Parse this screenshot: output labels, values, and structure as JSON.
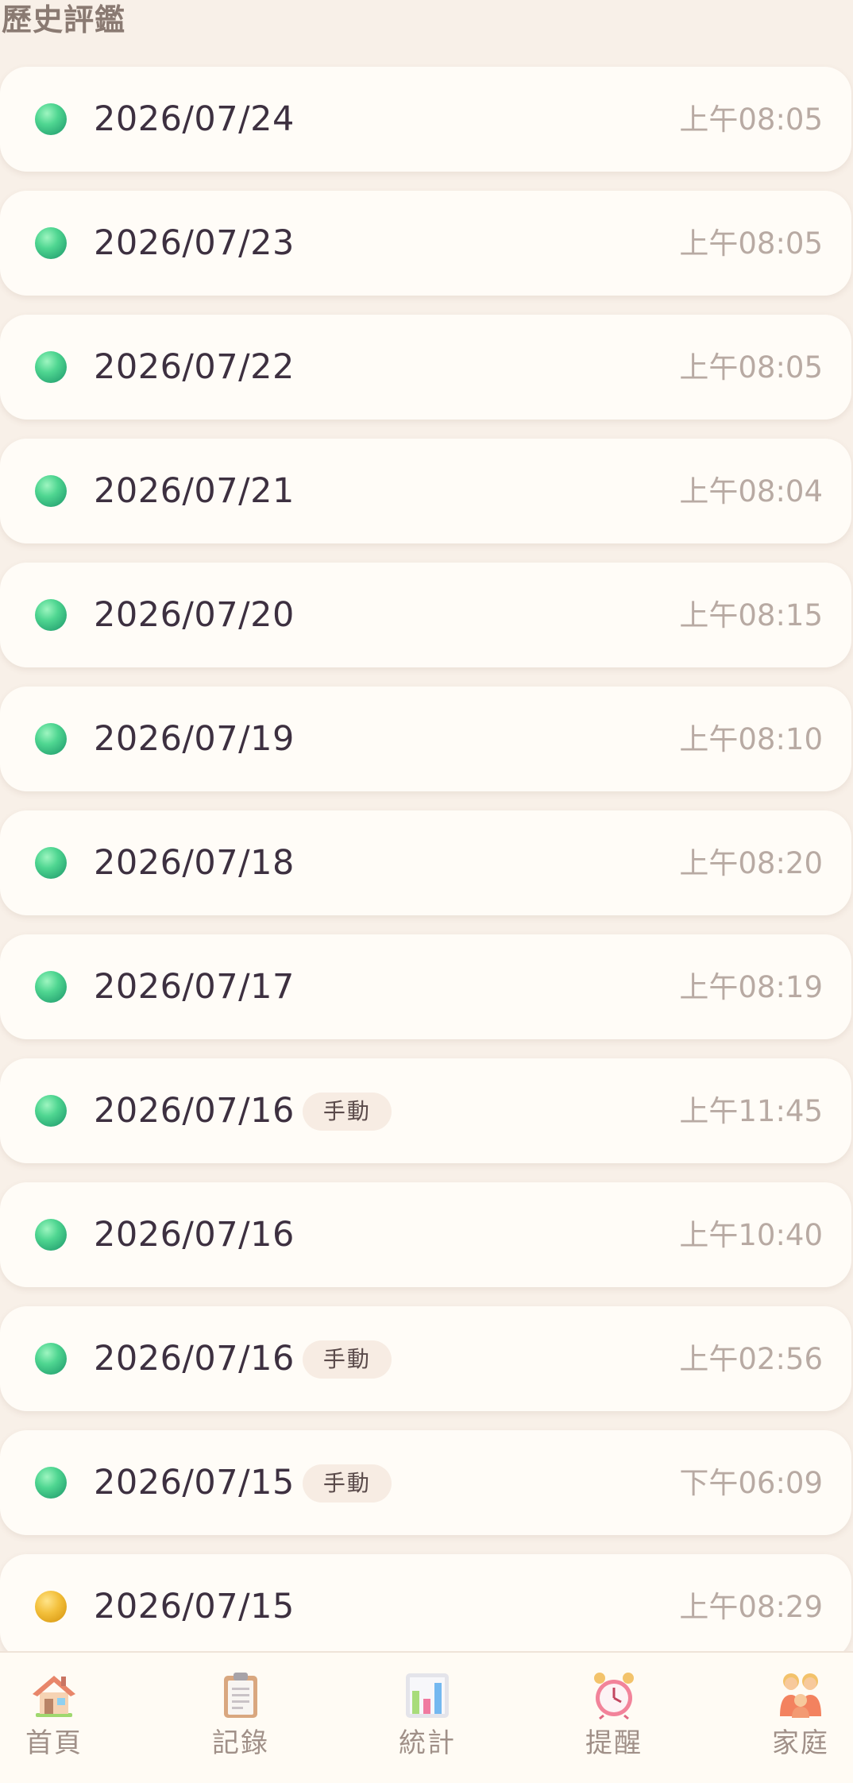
{
  "section": {
    "title": "歷史評鑑"
  },
  "history": [
    {
      "date": "2026/07/24",
      "tag": "",
      "time": "上午08:05",
      "status": "green"
    },
    {
      "date": "2026/07/23",
      "tag": "",
      "time": "上午08:05",
      "status": "green"
    },
    {
      "date": "2026/07/22",
      "tag": "",
      "time": "上午08:05",
      "status": "green"
    },
    {
      "date": "2026/07/21",
      "tag": "",
      "time": "上午08:04",
      "status": "green"
    },
    {
      "date": "2026/07/20",
      "tag": "",
      "time": "上午08:15",
      "status": "green"
    },
    {
      "date": "2026/07/19",
      "tag": "",
      "time": "上午08:10",
      "status": "green"
    },
    {
      "date": "2026/07/18",
      "tag": "",
      "time": "上午08:20",
      "status": "green"
    },
    {
      "date": "2026/07/17",
      "tag": "",
      "time": "上午08:19",
      "status": "green"
    },
    {
      "date": "2026/07/16",
      "tag": "手動",
      "time": "上午11:45",
      "status": "green"
    },
    {
      "date": "2026/07/16",
      "tag": "",
      "time": "上午10:40",
      "status": "green"
    },
    {
      "date": "2026/07/16",
      "tag": "手動",
      "time": "上午02:56",
      "status": "green"
    },
    {
      "date": "2026/07/15",
      "tag": "手動",
      "time": "下午06:09",
      "status": "green"
    },
    {
      "date": "2026/07/15",
      "tag": "",
      "time": "上午08:29",
      "status": "yellow"
    }
  ],
  "tabbar": {
    "items": [
      {
        "label": "首頁",
        "icon": "house-icon"
      },
      {
        "label": "記錄",
        "icon": "clipboard-icon"
      },
      {
        "label": "統計",
        "icon": "bar-chart-icon"
      },
      {
        "label": "提醒",
        "icon": "alarm-clock-icon"
      },
      {
        "label": "家庭",
        "icon": "family-icon"
      }
    ]
  },
  "colors": {
    "background": "#f8f0e8",
    "card": "#fffcf7",
    "status_green": "#3cc585",
    "status_yellow": "#f0b428"
  }
}
